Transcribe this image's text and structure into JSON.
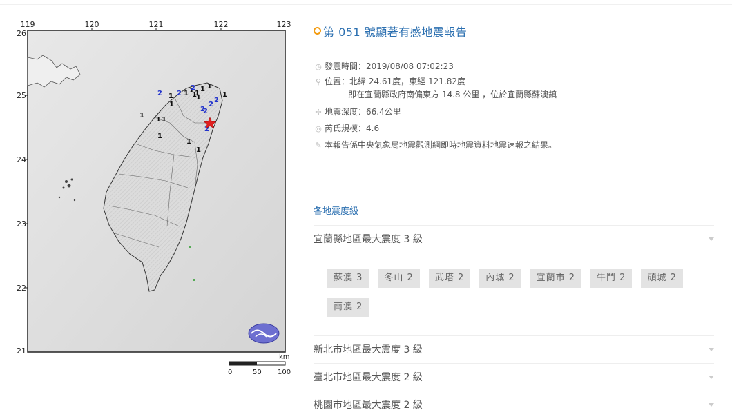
{
  "report": {
    "title": "第 051 號顯著有感地震報告",
    "origin_time": "發震時間：2019/08/08 07:02:23",
    "location": "位置：北緯 24.61度，東經 121.82度",
    "location_detail": "即在宜蘭縣政府南偏東方 14.8 公里 ，位於宜蘭縣蘇澳鎮",
    "depth": "地震深度：66.4公里",
    "magnitude": "芮氏規模：4.6",
    "note": "本報告係中央氣象局地震觀測網即時地震資料地震速報之結果。"
  },
  "icons": {
    "time": "clock-icon",
    "location": "pin-icon",
    "depth": "depth-icon",
    "magnitude": "magnitude-icon",
    "note": "pencil-icon"
  },
  "map": {
    "lon_ticks": [
      "119",
      "120",
      "121",
      "122",
      "123"
    ],
    "lat_ticks": [
      "26",
      "25",
      "24",
      "23",
      "22",
      "21"
    ],
    "scale_unit": "km",
    "scale_labels": [
      "0",
      "50",
      "100"
    ],
    "intensity_marks": [
      {
        "text": "2",
        "color": "#2233cc"
      },
      {
        "text": "1",
        "color": "#111111"
      },
      {
        "text": "2",
        "color": "#2233cc"
      },
      {
        "text": "1",
        "color": "#111111"
      },
      {
        "text": "1",
        "color": "#111111"
      },
      {
        "text": "2",
        "color": "#2233cc"
      },
      {
        "text": "1",
        "color": "#111111"
      },
      {
        "text": "1",
        "color": "#111111"
      },
      {
        "text": "1",
        "color": "#111111"
      },
      {
        "text": "1",
        "color": "#111111"
      },
      {
        "text": "1",
        "color": "#111111"
      },
      {
        "text": "1",
        "color": "#111111"
      },
      {
        "text": "2",
        "color": "#2233cc"
      },
      {
        "text": "2",
        "color": "#2233cc"
      },
      {
        "text": "2",
        "color": "#2233cc"
      },
      {
        "text": "2",
        "color": "#2233cc"
      },
      {
        "text": "1",
        "color": "#111111"
      },
      {
        "text": "1",
        "color": "#111111"
      },
      {
        "text": "1",
        "color": "#111111"
      },
      {
        "text": "1",
        "color": "#111111"
      },
      {
        "text": "1",
        "color": "#111111"
      },
      {
        "text": "1",
        "color": "#111111"
      },
      {
        "text": "2",
        "color": "#2233cc"
      },
      {
        "text": "1",
        "color": "#111111"
      }
    ],
    "epicenter_color": "#e02020"
  },
  "intensity": {
    "section_label": "各地震度級",
    "regions": [
      {
        "label": "宜蘭縣地區最大震度 3 級",
        "expanded": true
      },
      {
        "label": "新北市地區最大震度 3 級",
        "expanded": false
      },
      {
        "label": "臺北市地區最大震度 2 級",
        "expanded": false
      },
      {
        "label": "桃園市地區最大震度 2 級",
        "expanded": false
      }
    ],
    "stations": [
      "蘇澳 3",
      "冬山 2",
      "武塔 2",
      "內城 2",
      "宜蘭市 2",
      "牛鬥 2",
      "頭城 2",
      "南澳 2"
    ]
  },
  "colors": {
    "accent": "#2b6fb0",
    "title_dot": "#f39c12",
    "chip_bg": "#e3e3e3"
  }
}
